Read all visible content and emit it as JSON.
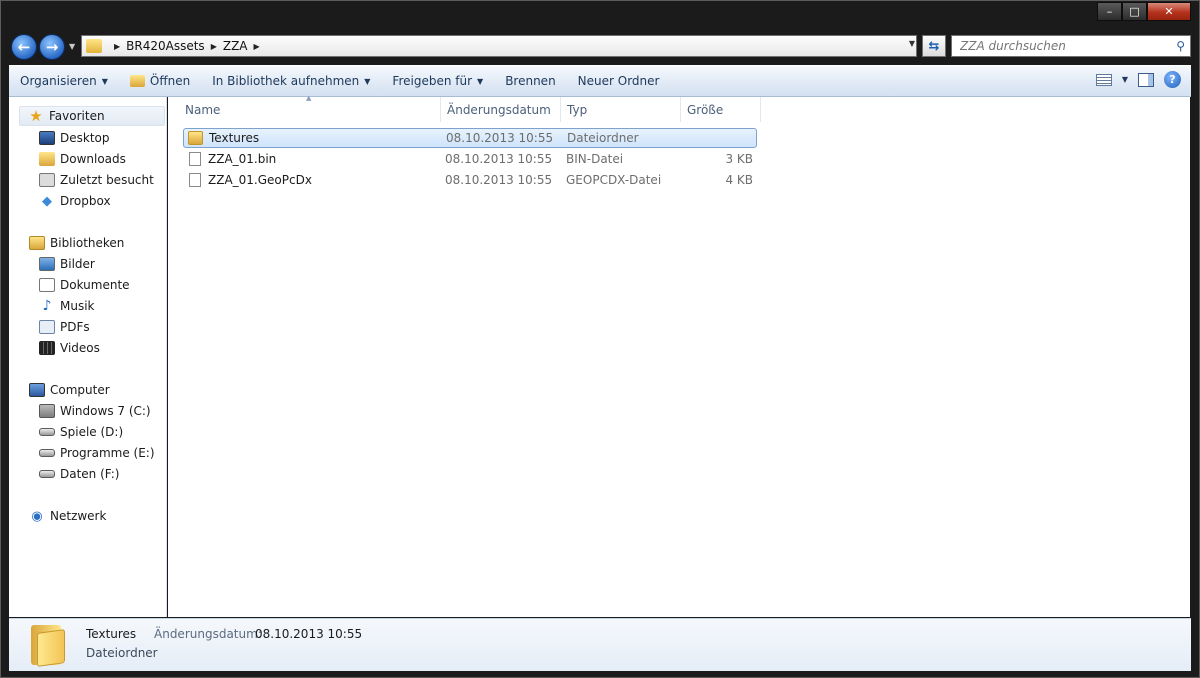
{
  "window": {
    "controls": {
      "minimize": "–",
      "maximize": "□",
      "close": "✕"
    }
  },
  "navigation": {
    "back_glyph": "←",
    "forward_glyph": "→",
    "breadcrumbs": [
      "BR420Assets",
      "ZZA"
    ],
    "search_placeholder": "ZZA durchsuchen"
  },
  "commandbar": {
    "organize": "Organisieren",
    "open": "Öffnen",
    "include_library": "In Bibliothek aufnehmen",
    "share": "Freigeben für",
    "burn": "Brennen",
    "new_folder": "Neuer Ordner",
    "help": "?"
  },
  "sidebar": {
    "favorites": {
      "label": "Favoriten",
      "items": [
        "Desktop",
        "Downloads",
        "Zuletzt besucht",
        "Dropbox"
      ]
    },
    "libraries": {
      "label": "Bibliotheken",
      "items": [
        "Bilder",
        "Dokumente",
        "Musik",
        "PDFs",
        "Videos"
      ]
    },
    "computer": {
      "label": "Computer",
      "items": [
        "Windows 7 (C:)",
        "Spiele (D:)",
        "Programme (E:)",
        "Daten (F:)"
      ]
    },
    "network": {
      "label": "Netzwerk"
    }
  },
  "filelist": {
    "columns": {
      "name": "Name",
      "date": "Änderungsdatum",
      "type": "Typ",
      "size": "Größe"
    },
    "rows": [
      {
        "name": "Textures",
        "date": "08.10.2013 10:55",
        "type": "Dateiordner",
        "size": "",
        "icon": "folder-icon"
      },
      {
        "name": "ZZA_01.bin",
        "date": "08.10.2013 10:55",
        "type": "BIN-Datei",
        "size": "3 KB",
        "icon": "file-icon"
      },
      {
        "name": "ZZA_01.GeoPcDx",
        "date": "08.10.2013 10:55",
        "type": "GEOPCDX-Datei",
        "size": "4 KB",
        "icon": "file-icon"
      }
    ]
  },
  "details": {
    "name": "Textures",
    "date_label": "Änderungsdatum:",
    "date": "08.10.2013 10:55",
    "type": "Dateiordner"
  }
}
